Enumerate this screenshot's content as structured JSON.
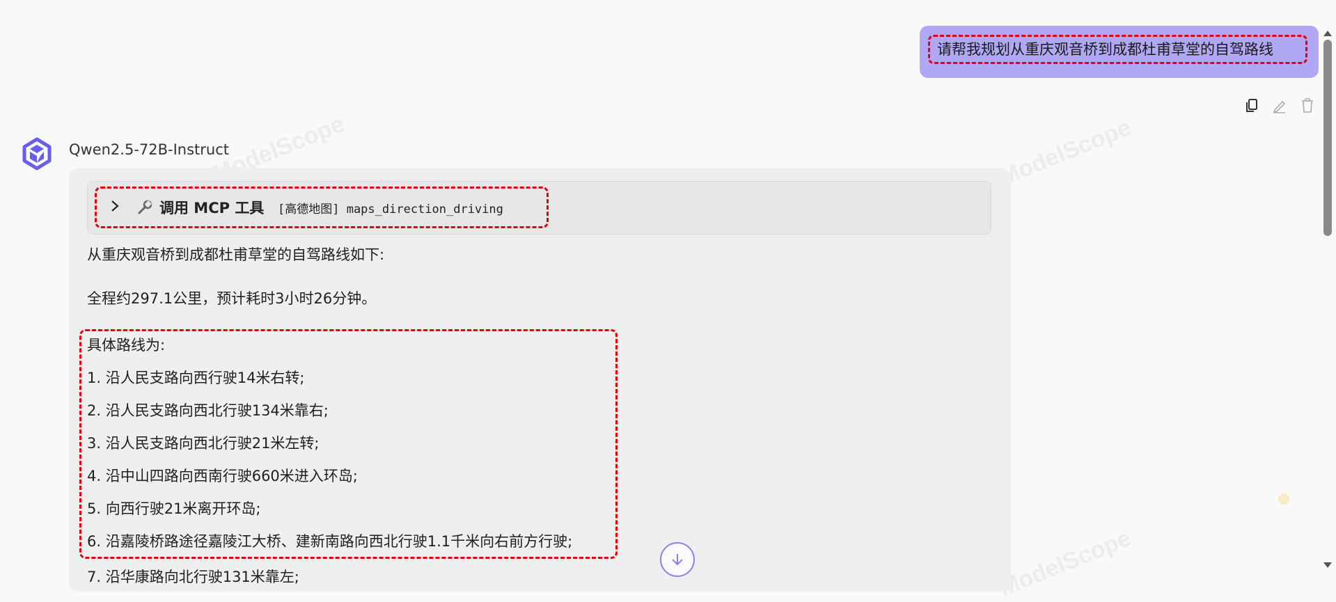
{
  "user_message": "请帮我规划从重庆观音桥到成都杜甫草堂的自驾路线",
  "message_actions": {
    "copy_icon": "copy-icon",
    "edit_icon": "pencil-icon",
    "delete_icon": "trash-icon"
  },
  "assistant": {
    "model_name": "Qwen2.5-72B-Instruct",
    "tool_call": {
      "label": "调用 MCP 工具",
      "code": "[高德地图] maps_direction_driving"
    },
    "intro": "从重庆观音桥到成都杜甫草堂的自驾路线如下:",
    "summary": "全程约297.1公里，预计耗时3小时26分钟。",
    "steps_heading": "具体路线为:",
    "steps": [
      "1. 沿人民支路向西行驶14米右转;",
      "2. 沿人民支路向西北行驶134米靠右;",
      "3. 沿人民支路向西北行驶21米左转;",
      "4. 沿中山四路向西南行驶660米进入环岛;",
      "5. 向西行驶21米离开环岛;",
      "6. 沿嘉陵桥路途径嘉陵江大桥、建新南路向西北行驶1.1千米向右前方行驶;",
      "7. 沿华康路向北行驶131米靠左;"
    ]
  },
  "watermark": "ModelScope",
  "colors": {
    "user_bubble": "#b0a8f5",
    "highlight": "#e3000f",
    "accent": "#8b80f0"
  }
}
